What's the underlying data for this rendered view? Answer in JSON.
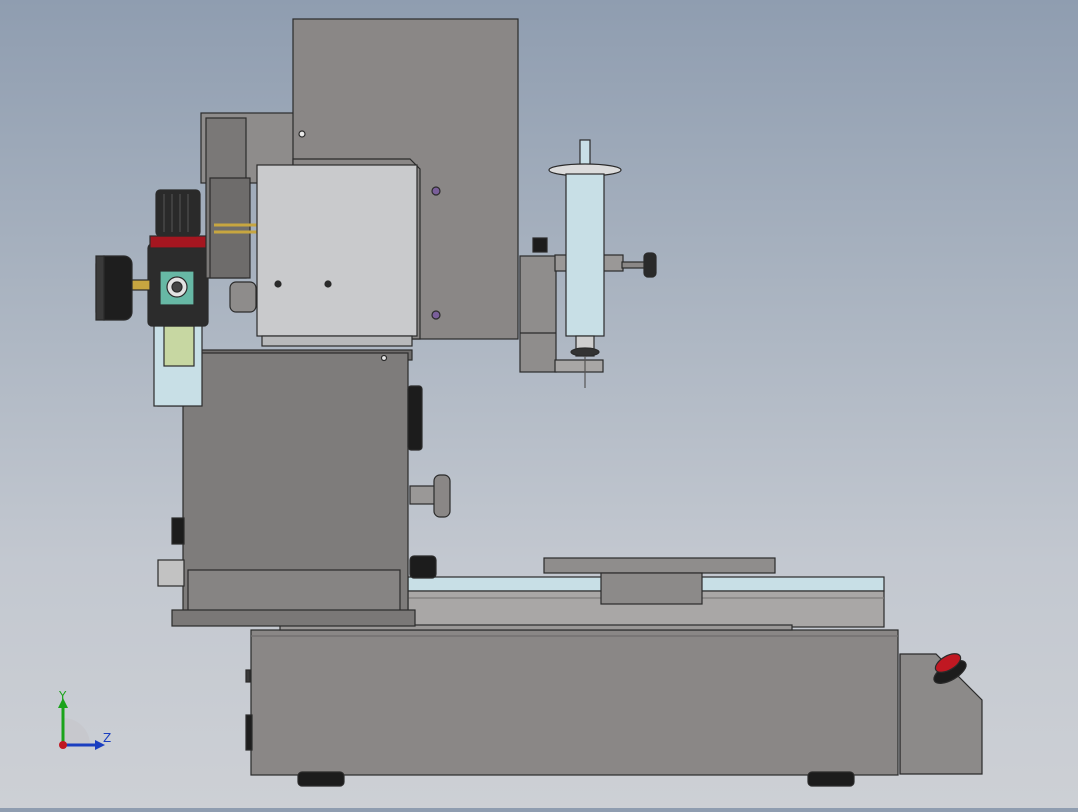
{
  "viewport": {
    "background_top": "#8f9db0",
    "background_bottom": "#cdd0d5"
  },
  "model": {
    "body_color": "#8a8786",
    "panel_color": "#c9cacc",
    "dark_color": "#2b2b2b",
    "glass_color": "#c8dfe6",
    "accent_red": "#c01822",
    "fitting_gold": "#c7a640"
  },
  "triad": {
    "y_label": "Y",
    "z_label": "Z",
    "y_color": "#1aa31a",
    "z_color": "#1a3ec0",
    "x_color": "#c01822"
  }
}
